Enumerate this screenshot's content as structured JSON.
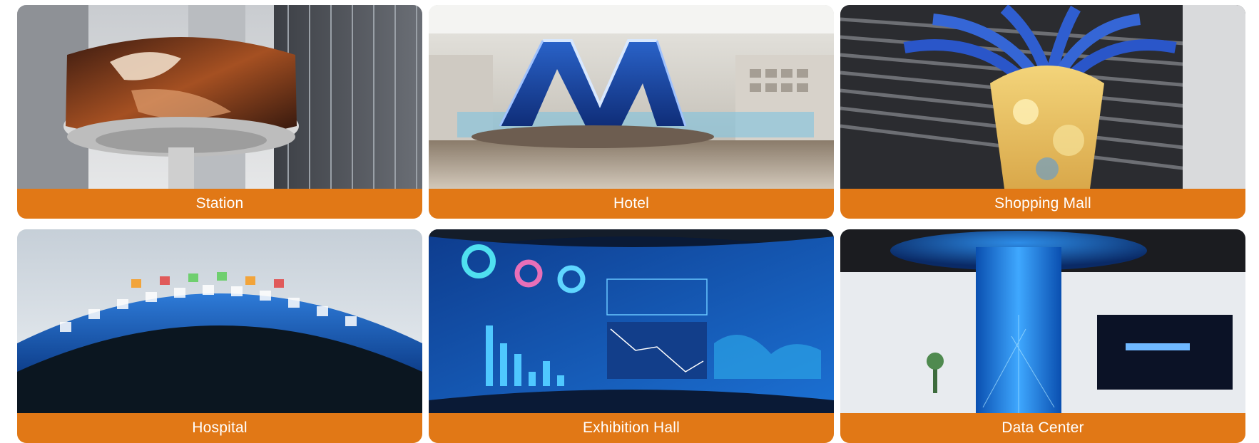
{
  "colors": {
    "caption_bg": "#e17816",
    "caption_text": "#ffffff"
  },
  "cards": [
    {
      "label": "Station",
      "icon": "curved-led-screen-photo"
    },
    {
      "label": "Hotel",
      "icon": "m-shaped-led-sculpture-photo"
    },
    {
      "label": "Shopping Mall",
      "icon": "tree-shaped-led-display-photo"
    },
    {
      "label": "Hospital",
      "icon": "ring-led-display-photo"
    },
    {
      "label": "Exhibition Hall",
      "icon": "curved-dashboard-wall-photo"
    },
    {
      "label": "Data Center",
      "icon": "cylindrical-led-column-photo"
    }
  ]
}
